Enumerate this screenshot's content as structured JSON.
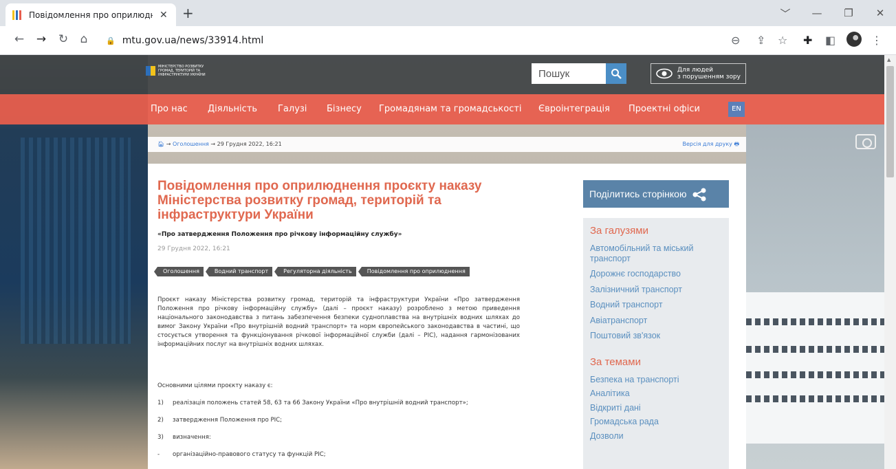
{
  "browser": {
    "tab_title": "Повідомлення про оприлюднення",
    "tab_close": "✕",
    "new_tab": "+",
    "url": "mtu.gov.ua/news/33914.html",
    "window_controls": [
      "﹀",
      "—",
      "❐",
      "✕"
    ]
  },
  "header": {
    "logo_text": "МІНІСТЕРСТВО РОЗВИТКУ ГРОМАД, ТЕРИТОРІЙ ТА ІНФРАСТРУКТУРИ УКРАЇНИ",
    "search_placeholder": "Пошук",
    "a11y_line1": "Для людей",
    "a11y_line2": "з порушенням зору"
  },
  "nav": {
    "items": [
      "Про нас",
      "Діяльність",
      "Галузі",
      "Бізнесу",
      "Громадянам та громадськості",
      "Євроінтеграція",
      "Проектні офіси"
    ],
    "lang": "EN"
  },
  "breadcrumb": {
    "arrow": "→",
    "section": "Оголошення",
    "current": "29 Грудня 2022, 16:21",
    "print": "Версія для друку"
  },
  "article": {
    "title": "Повідомлення про оприлюднення проєкту наказу Міністерства розвитку громад, територій та інфраструктури України",
    "subtitle": "«Про затвердження Положення про річкову інформаційну службу»",
    "date": "29 Грудня 2022, 16:21",
    "tags": [
      "Оголошення",
      "Водний транспорт",
      "Регуляторна діяльність",
      "Повідомлення про оприлюднення"
    ],
    "paragraph": "Проєкт наказу Міністерства розвитку громад, територій та інфраструктури України «Про затвердження Положення про річкову інформаційну службу» (далі – проєкт наказу) розроблено з метою приведення національного законодавства з питань забезпечення безпеки судноплавства на внутрішніх водних шляхах до вимог Закону України «Про внутрішній водний транспорт» та норм європейського законодавства в частині, що стосується утворення та функціонування річкової інформаційної служби (далі – РІС), надання гармонізованих інформаційних послуг на внутрішніх водних шляхах.",
    "goals_intro": "Основними цілями проєкту наказу є:",
    "list": [
      {
        "num": "1)",
        "text": "реалізація положень статей 58, 63 та 66 Закону України «Про внутрішній водний транспорт»;"
      },
      {
        "num": "2)",
        "text": "затвердження Положення про РІС;"
      },
      {
        "num": "3)",
        "text": "визначення:"
      },
      {
        "num": "-",
        "text": "організаційно-правового статусу та функцій РІС;"
      }
    ]
  },
  "sidebar": {
    "share_label": "Поділитись сторінкою",
    "industries_heading": "За галузями",
    "industries": [
      "Автомобільний та міський транспорт",
      "Дорожнє господарство",
      "Залізничний транспорт",
      "Водний транспорт",
      "Авіатранспорт",
      "Поштовий зв'язок"
    ],
    "topics_heading": "За темами",
    "topics": [
      "Безпека на транспорті",
      "Аналітика",
      "Відкриті дані",
      "Громадська рада",
      "Дозволи"
    ]
  },
  "colors": {
    "accent": "#e0684f",
    "nav_bg": "#e85d4c",
    "link": "#5a8fbf",
    "share_bg": "#5a83a8"
  }
}
